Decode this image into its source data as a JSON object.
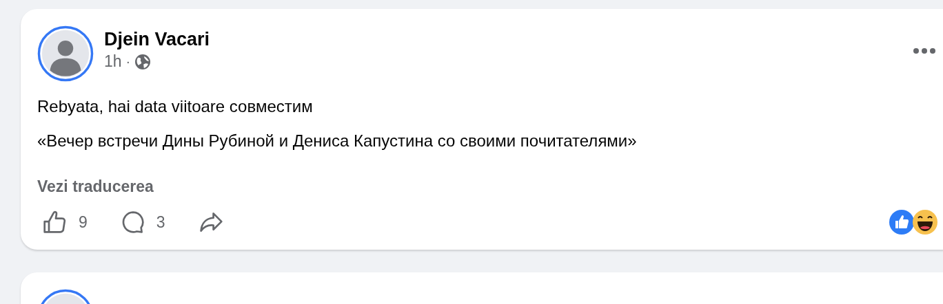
{
  "posts": [
    {
      "author": "Djein Vacari",
      "time": "1h",
      "separator": "·",
      "paragraphs": [
        "Rebyata, hai data viitoare совместим",
        "«Вечер встречи Дины Рубиной и Дениса Капустина со своими почитателями»"
      ],
      "translate_link": "Vezi traducerea",
      "likes": "9",
      "comments": "3",
      "reactions": [
        {
          "kind": "like"
        },
        {
          "kind": "haha"
        }
      ]
    },
    {
      "kind": "cut_off"
    }
  ]
}
